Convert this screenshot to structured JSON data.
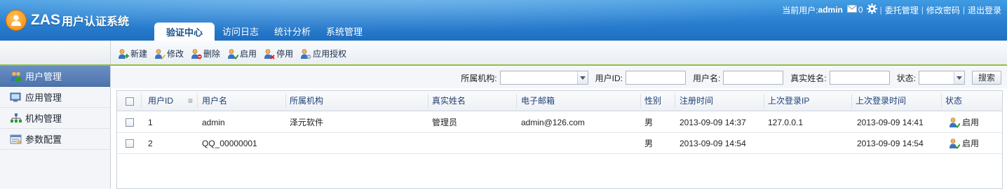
{
  "header": {
    "brand": "ZAS",
    "subtitle": "用户认证系统",
    "nav": [
      {
        "label": "验证中心",
        "active": true
      },
      {
        "label": "访问日志",
        "active": false
      },
      {
        "label": "统计分析",
        "active": false
      },
      {
        "label": "系统管理",
        "active": false
      }
    ],
    "current_user_label": "当前用户:",
    "current_user": "admin",
    "message_count": "0",
    "links": [
      "委托管理",
      "修改密码",
      "退出登录"
    ]
  },
  "toolbar": {
    "buttons": [
      {
        "label": "新建",
        "icon": "user-add-icon"
      },
      {
        "label": "修改",
        "icon": "user-edit-icon"
      },
      {
        "label": "删除",
        "icon": "user-delete-icon"
      },
      {
        "label": "启用",
        "icon": "user-enable-icon"
      },
      {
        "label": "停用",
        "icon": "user-disable-icon"
      },
      {
        "label": "应用授权",
        "icon": "app-authorize-icon"
      }
    ]
  },
  "sidebar": {
    "items": [
      {
        "label": "用户管理",
        "icon": "users-icon",
        "active": true
      },
      {
        "label": "应用管理",
        "icon": "computer-icon",
        "active": false
      },
      {
        "label": "机构管理",
        "icon": "org-tree-icon",
        "active": false
      },
      {
        "label": "参数配置",
        "icon": "settings-icon",
        "active": false
      }
    ]
  },
  "filter": {
    "org_label": "所属机构:",
    "org_value": "",
    "userid_label": "用户ID:",
    "userid_value": "",
    "username_label": "用户名:",
    "username_value": "",
    "realname_label": "真实姓名:",
    "realname_value": "",
    "status_label": "状态:",
    "status_value": "",
    "search_label": "搜索"
  },
  "grid": {
    "columns": [
      "用户ID",
      "用户名",
      "所属机构",
      "真实姓名",
      "电子邮箱",
      "性别",
      "注册时间",
      "上次登录IP",
      "上次登录时间",
      "状态"
    ],
    "sort_icon": "≡",
    "rows": [
      {
        "id": "1",
        "username": "admin",
        "org": "泽元软件",
        "realname": "管理员",
        "email": "admin@126.com",
        "gender": "男",
        "reg_time": "2013-09-09 14:37",
        "last_ip": "127.0.0.1",
        "last_login": "2013-09-09 14:41",
        "status": "启用"
      },
      {
        "id": "2",
        "username": "QQ_00000001",
        "org": "",
        "realname": "",
        "email": "",
        "gender": "男",
        "reg_time": "2013-09-09 14:54",
        "last_ip": "",
        "last_login": "2013-09-09 14:54",
        "status": "启用"
      }
    ]
  }
}
